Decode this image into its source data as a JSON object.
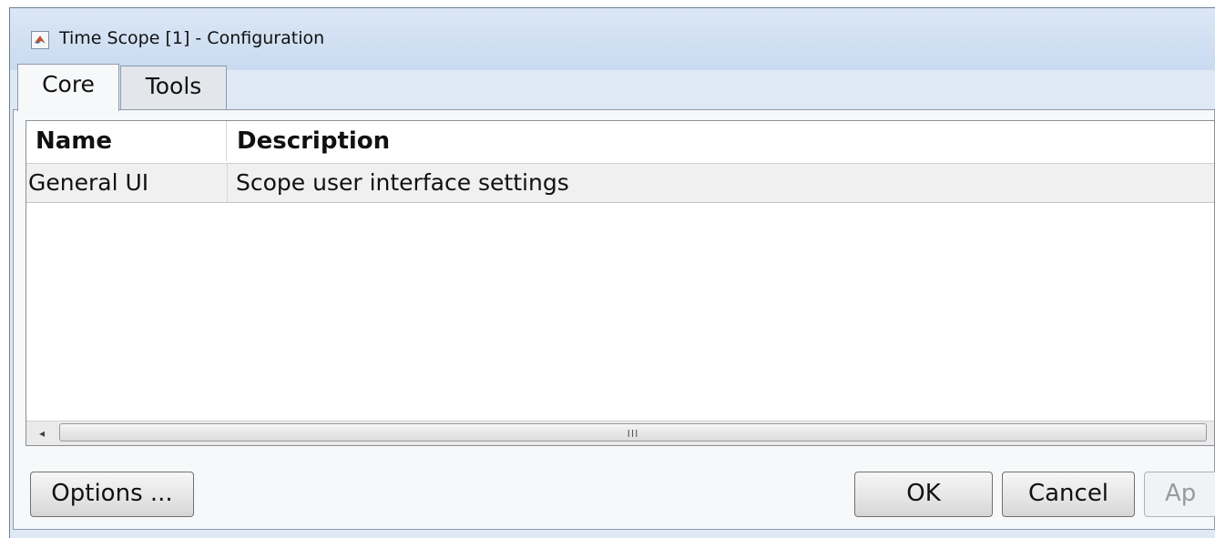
{
  "window": {
    "title": "Time Scope [1] - Configuration",
    "title_icon": "matlab-logo-icon"
  },
  "tabs": [
    {
      "label": "Core",
      "selected": true
    },
    {
      "label": "Tools",
      "selected": false
    }
  ],
  "table": {
    "columns": [
      "Name",
      "Description"
    ],
    "rows": [
      {
        "name": "General UI",
        "description": "Scope user interface settings"
      }
    ],
    "scrollbar": {
      "left_arrow": "◂",
      "grip": "III"
    }
  },
  "buttons": {
    "options": "Options ...",
    "ok": "OK",
    "cancel": "Cancel",
    "apply": "Ap"
  },
  "colors": {
    "window_bg": "#dfe9f5",
    "panel_bg": "#f7f8f9",
    "row_bg": "#f0f0f0"
  }
}
